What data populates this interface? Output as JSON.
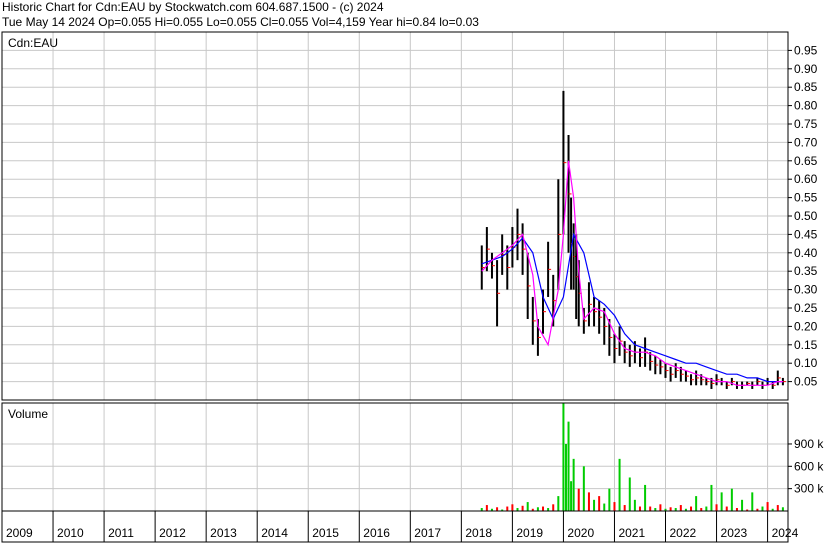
{
  "header": {
    "line1": "Historic Chart for Cdn:EAU by Stockwatch.com 604.687.1500 - (c) 2024",
    "line2": "Tue May 14 2024   Op=0.055   Hi=0.055   Lo=0.055   Cl=0.055   Vol=4,159   Year hi=0.84   lo=0.03"
  },
  "colors": {
    "background": "#ffffff",
    "grid": "#c8c8c8",
    "price_bar": "#000000",
    "close_tick": "#ff0000",
    "ma_short": "#ff00ff",
    "ma_long": "#0000ff",
    "volume_up": "#00cc00",
    "volume_down": "#ff0000",
    "volume_flat": "#a0a0a0"
  },
  "chart_data": [
    {
      "type": "line",
      "panel": "price",
      "symbol_label": "Cdn:EAU",
      "y_ticks": [
        "0.95",
        "0.90",
        "0.85",
        "0.80",
        "0.75",
        "0.70",
        "0.65",
        "0.60",
        "0.55",
        "0.50",
        "0.45",
        "0.40",
        "0.35",
        "0.30",
        "0.25",
        "0.20",
        "0.15",
        "0.10",
        "0.05"
      ],
      "ylim": [
        0,
        1.0
      ],
      "grid": true,
      "x_ticks": [
        "2009",
        "2010",
        "2011",
        "2012",
        "2013",
        "2014",
        "2015",
        "2016",
        "2017",
        "2018",
        "2019",
        "2020",
        "2021",
        "2022",
        "2023",
        "2024"
      ],
      "xlim": [
        2009.0,
        2024.4
      ],
      "series": [
        {
          "style": "ohlc",
          "x": [
            2018.4,
            2018.5,
            2018.6,
            2018.7,
            2018.8,
            2018.9,
            2019.0,
            2019.1,
            2019.2,
            2019.3,
            2019.4,
            2019.5,
            2019.6,
            2019.7,
            2019.8,
            2019.9,
            2020.0,
            2020.1,
            2020.15,
            2020.2,
            2020.25,
            2020.3,
            2020.4,
            2020.5,
            2020.6,
            2020.7,
            2020.8,
            2020.9,
            2021.0,
            2021.1,
            2021.2,
            2021.3,
            2021.4,
            2021.5,
            2021.6,
            2021.7,
            2021.8,
            2021.9,
            2022.0,
            2022.1,
            2022.2,
            2022.3,
            2022.4,
            2022.5,
            2022.6,
            2022.7,
            2022.8,
            2022.9,
            2023.0,
            2023.1,
            2023.2,
            2023.3,
            2023.4,
            2023.5,
            2023.6,
            2023.7,
            2023.8,
            2023.9,
            2024.0,
            2024.1,
            2024.2,
            2024.3
          ],
          "high": [
            0.42,
            0.47,
            0.4,
            0.38,
            0.45,
            0.42,
            0.47,
            0.52,
            0.48,
            0.4,
            0.28,
            0.22,
            0.3,
            0.43,
            0.34,
            0.6,
            0.84,
            0.72,
            0.55,
            0.48,
            0.45,
            0.38,
            0.25,
            0.32,
            0.28,
            0.27,
            0.25,
            0.22,
            0.18,
            0.2,
            0.16,
            0.15,
            0.16,
            0.14,
            0.17,
            0.13,
            0.12,
            0.11,
            0.1,
            0.09,
            0.1,
            0.09,
            0.08,
            0.07,
            0.08,
            0.07,
            0.06,
            0.06,
            0.07,
            0.06,
            0.05,
            0.06,
            0.05,
            0.05,
            0.05,
            0.05,
            0.06,
            0.05,
            0.06,
            0.05,
            0.08,
            0.06
          ],
          "low": [
            0.3,
            0.35,
            0.33,
            0.2,
            0.34,
            0.3,
            0.36,
            0.38,
            0.34,
            0.22,
            0.15,
            0.12,
            0.18,
            0.28,
            0.2,
            0.3,
            0.45,
            0.4,
            0.3,
            0.3,
            0.22,
            0.2,
            0.18,
            0.2,
            0.2,
            0.18,
            0.15,
            0.12,
            0.1,
            0.12,
            0.1,
            0.09,
            0.1,
            0.09,
            0.09,
            0.08,
            0.07,
            0.07,
            0.06,
            0.05,
            0.06,
            0.05,
            0.05,
            0.04,
            0.04,
            0.04,
            0.04,
            0.03,
            0.04,
            0.04,
            0.03,
            0.04,
            0.03,
            0.03,
            0.04,
            0.03,
            0.04,
            0.03,
            0.04,
            0.03,
            0.04,
            0.04
          ]
        },
        {
          "name": "",
          "style": "ma_short",
          "x": [
            2018.4,
            2018.6,
            2018.8,
            2019.0,
            2019.2,
            2019.4,
            2019.5,
            2019.7,
            2019.9,
            2020.0,
            2020.1,
            2020.2,
            2020.3,
            2020.4,
            2020.6,
            2020.8,
            2021.0,
            2021.2,
            2021.4,
            2021.6,
            2021.8,
            2022.0,
            2022.2,
            2022.4,
            2022.6,
            2022.8,
            2023.0,
            2023.2,
            2023.4,
            2023.6,
            2023.8,
            2024.0,
            2024.2,
            2024.3
          ],
          "y": [
            0.35,
            0.38,
            0.4,
            0.42,
            0.45,
            0.34,
            0.2,
            0.15,
            0.3,
            0.45,
            0.65,
            0.55,
            0.35,
            0.22,
            0.25,
            0.24,
            0.18,
            0.14,
            0.13,
            0.13,
            0.12,
            0.1,
            0.09,
            0.08,
            0.07,
            0.06,
            0.05,
            0.05,
            0.04,
            0.04,
            0.04,
            0.04,
            0.05,
            0.05
          ]
        },
        {
          "name": "",
          "style": "ma_long",
          "x": [
            2018.4,
            2018.6,
            2018.8,
            2019.0,
            2019.2,
            2019.4,
            2019.6,
            2019.8,
            2020.0,
            2020.2,
            2020.4,
            2020.6,
            2020.8,
            2021.0,
            2021.2,
            2021.4,
            2021.6,
            2021.8,
            2022.0,
            2022.2,
            2022.4,
            2022.6,
            2022.8,
            2023.0,
            2023.2,
            2023.4,
            2023.6,
            2023.8,
            2024.0,
            2024.2,
            2024.3
          ],
          "y": [
            0.37,
            0.38,
            0.39,
            0.41,
            0.44,
            0.4,
            0.28,
            0.22,
            0.28,
            0.45,
            0.4,
            0.28,
            0.26,
            0.23,
            0.18,
            0.15,
            0.14,
            0.13,
            0.12,
            0.11,
            0.1,
            0.1,
            0.09,
            0.08,
            0.07,
            0.07,
            0.06,
            0.06,
            0.05,
            0.05,
            0.05
          ]
        }
      ]
    },
    {
      "type": "bar",
      "panel": "volume",
      "label": "Volume",
      "y_ticks": [
        "900 k",
        "600 k",
        "300 k"
      ],
      "ylim": [
        0,
        1450000
      ],
      "x_ticks": [
        "2009",
        "2010",
        "2011",
        "2012",
        "2013",
        "2014",
        "2015",
        "2016",
        "2017",
        "2018",
        "2019",
        "2020",
        "2021",
        "2022",
        "2023",
        "2024"
      ],
      "x": [
        2018.4,
        2018.5,
        2018.6,
        2018.7,
        2018.8,
        2018.9,
        2019.0,
        2019.1,
        2019.2,
        2019.3,
        2019.4,
        2019.5,
        2019.6,
        2019.7,
        2019.8,
        2019.9,
        2020.0,
        2020.05,
        2020.1,
        2020.15,
        2020.2,
        2020.3,
        2020.4,
        2020.5,
        2020.6,
        2020.7,
        2020.8,
        2020.9,
        2021.0,
        2021.1,
        2021.2,
        2021.3,
        2021.4,
        2021.5,
        2021.6,
        2021.7,
        2021.8,
        2021.9,
        2022.0,
        2022.1,
        2022.2,
        2022.3,
        2022.4,
        2022.5,
        2022.6,
        2022.7,
        2022.8,
        2022.9,
        2023.0,
        2023.1,
        2023.2,
        2023.3,
        2023.4,
        2023.5,
        2023.6,
        2023.7,
        2023.8,
        2023.9,
        2024.0,
        2024.1,
        2024.2,
        2024.3
      ],
      "values": [
        40000,
        80000,
        30000,
        50000,
        20000,
        60000,
        90000,
        40000,
        70000,
        120000,
        30000,
        50000,
        60000,
        40000,
        90000,
        200000,
        1450000,
        900000,
        1200000,
        400000,
        700000,
        300000,
        600000,
        250000,
        150000,
        200000,
        100000,
        300000,
        120000,
        700000,
        80000,
        450000,
        150000,
        60000,
        350000,
        60000,
        40000,
        90000,
        30000,
        50000,
        40000,
        80000,
        30000,
        60000,
        200000,
        40000,
        60000,
        350000,
        90000,
        250000,
        60000,
        300000,
        40000,
        150000,
        20000,
        250000,
        30000,
        60000,
        120000,
        30000,
        80000,
        50000
      ],
      "colors": [
        "up",
        "down",
        "up",
        "down",
        "up",
        "down",
        "down",
        "up",
        "down",
        "up",
        "down",
        "up",
        "down",
        "up",
        "down",
        "up",
        "up",
        "up",
        "up",
        "up",
        "up",
        "down",
        "up",
        "down",
        "up",
        "down",
        "up",
        "up",
        "down",
        "up",
        "down",
        "up",
        "up",
        "down",
        "up",
        "down",
        "up",
        "down",
        "up",
        "down",
        "up",
        "down",
        "up",
        "down",
        "up",
        "down",
        "up",
        "up",
        "down",
        "up",
        "down",
        "up",
        "down",
        "up",
        "down",
        "up",
        "down",
        "up",
        "down",
        "up",
        "down",
        "up"
      ]
    }
  ]
}
